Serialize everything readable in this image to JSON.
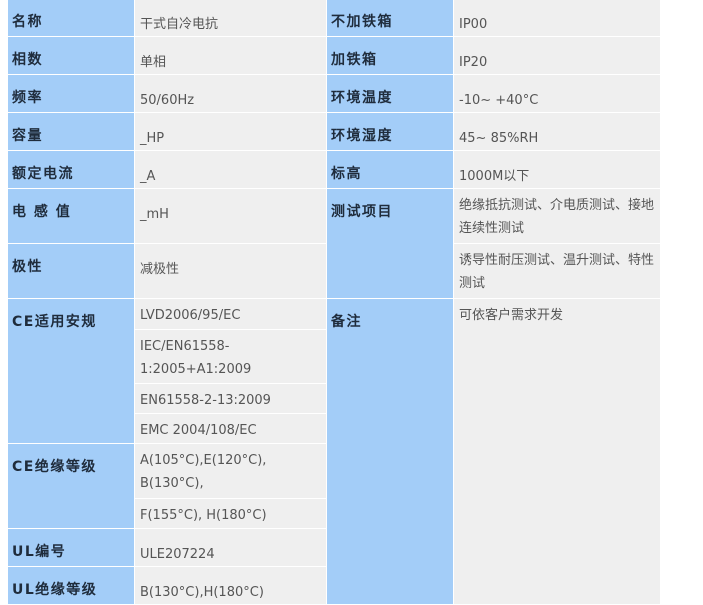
{
  "rows": {
    "r1": {
      "l1": "名称",
      "v1": "干式自冷电抗",
      "l2": "不加铁箱",
      "v2": "IP00"
    },
    "r2": {
      "l1": "相数",
      "v1": "单相",
      "l2": "加铁箱",
      "v2": "IP20"
    },
    "r3": {
      "l1": "频率",
      "v1": "50/60Hz",
      "l2": "环境温度",
      "v2": "-10~ +40°C"
    },
    "r4": {
      "l1": "容量",
      "v1": "_HP",
      "l2": "环境湿度",
      "v2": "45~ 85%RH"
    },
    "r5": {
      "l1": "额定电流",
      "v1": "_A",
      "l2": "标高",
      "v2": "1000M以下"
    },
    "r6": {
      "l1": "电 感 值",
      "v1": "_mH",
      "l2": "测试项目",
      "v2": "绝缘抵抗测试、介电质测试、接地连续性测试"
    },
    "r7": {
      "l1": "极性",
      "v1": "减极性",
      "v2": "诱导性耐压测试、温升测试、特性测试"
    },
    "ce_safety": {
      "label": "CE适用安规",
      "items": [
        "LVD2006/95/EC",
        "IEC/EN61558-1:2005+A1:2009",
        "EN61558-2-13:2009",
        "EMC 2004/108/EC"
      ]
    },
    "remark": {
      "label": "备注",
      "value": "可依客户需求开发"
    },
    "ce_insulation": {
      "label": "CE绝缘等级",
      "items": [
        "A(105°C),E(120°C), B(130°C),",
        "F(155°C), H(180°C)"
      ]
    },
    "ul_no": {
      "label": "UL编号",
      "value": "ULE207224"
    },
    "ul_insulation": {
      "label": "UL绝缘等级",
      "value": "B(130°C),H(180°C)"
    }
  }
}
